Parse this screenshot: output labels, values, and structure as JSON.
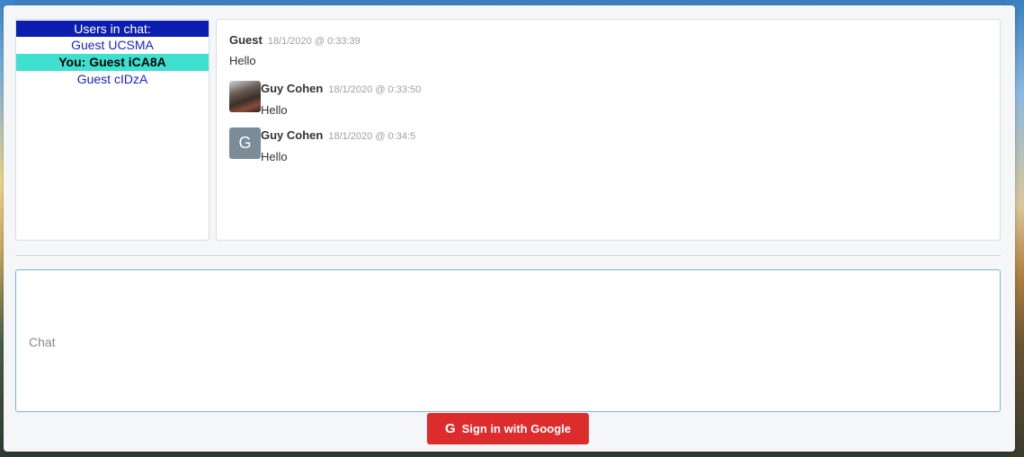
{
  "users_panel": {
    "header": "Users in chat:",
    "users": [
      {
        "label": "Guest UCSMA",
        "is_me": false
      },
      {
        "label": "You: Guest iCA8A",
        "is_me": true
      },
      {
        "label": "Guest cIDzA",
        "is_me": false
      }
    ]
  },
  "messages": [
    {
      "author": "Guest",
      "time": "18/1/2020 @ 0:33:39",
      "text": "Hello",
      "avatar": "none"
    },
    {
      "author": "Guy Cohen",
      "time": "18/1/2020 @ 0:33:50",
      "text": "Hello",
      "avatar": "photo"
    },
    {
      "author": "Guy Cohen",
      "time": "18/1/2020 @ 0:34:5",
      "text": "Hello",
      "avatar": "letter",
      "avatar_letter": "G"
    }
  ],
  "chat_input": {
    "placeholder": "Chat",
    "value": ""
  },
  "sign_in": {
    "label": "Sign in with Google",
    "icon_glyph": "G"
  },
  "colors": {
    "users_header_bg": "#0c1eb0",
    "me_highlight": "#40e0d0",
    "user_link": "#1a24c8",
    "google_button": "#dd2c2c"
  }
}
